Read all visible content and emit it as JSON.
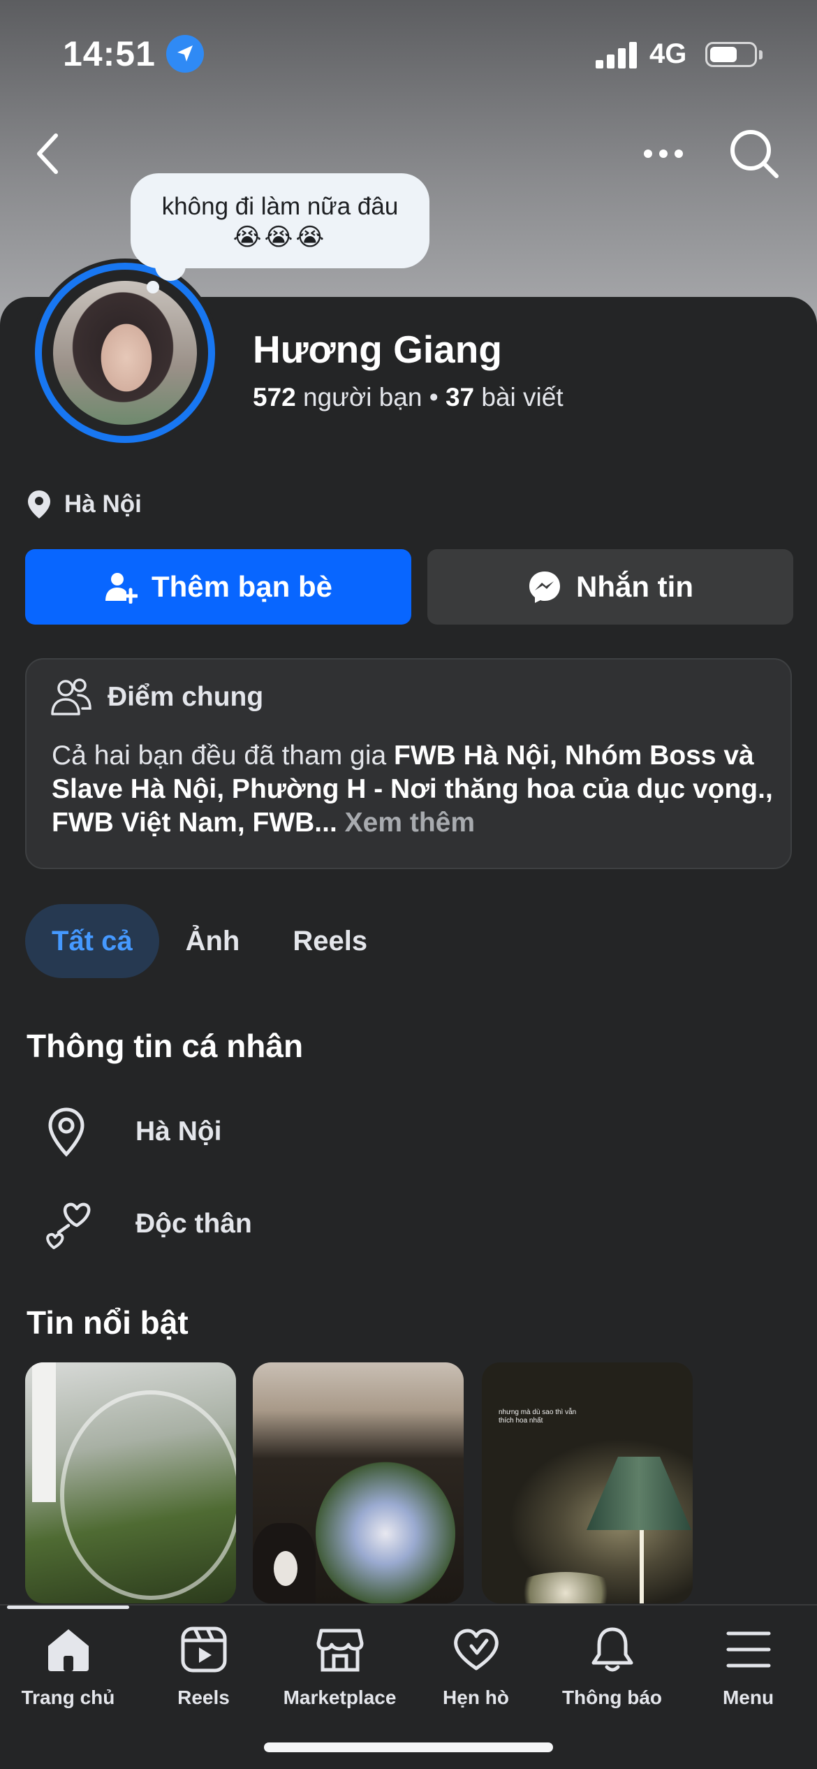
{
  "status_bar": {
    "time": "14:51",
    "network": "4G",
    "battery_level": 0.6
  },
  "colors": {
    "accent": "#0866ff",
    "ring": "#1877f2",
    "background": "#242526",
    "active_tab_bg": "#263951",
    "active_tab_text": "#4599ff"
  },
  "profile": {
    "status_note": "không đi làm nữa đâu",
    "status_emoji": "😭😭😭",
    "name": "Hương Giang",
    "friends_count": "572",
    "friends_label": " người bạn",
    "separator": " • ",
    "posts_count": "37",
    "posts_label": " bài viết",
    "location": "Hà Nội"
  },
  "actions": {
    "add_friend": "Thêm bạn bè",
    "message": "Nhắn tin"
  },
  "common": {
    "title": "Điểm chung",
    "text_prefix": "Cả hai bạn đều đã tham gia ",
    "groups_bold": "FWB Hà Nội, Nhóm Boss và Slave Hà Nội, Phường H - Nơi thăng hoa của dục vọng., FWB Việt Nam, FWB",
    "ellipsis": "... ",
    "see_more": "Xem thêm"
  },
  "filter_tabs": [
    {
      "label": "Tất cả",
      "active": true
    },
    {
      "label": "Ảnh",
      "active": false
    },
    {
      "label": "Reels",
      "active": false
    }
  ],
  "personal_info": {
    "title": "Thông tin cá nhân",
    "location": "Hà Nội",
    "relationship": "Độc thân"
  },
  "highlights": {
    "title": "Tin nổi bật",
    "story3_caption": "nhưng mà dù sao thì vẫn thích hoa nhất"
  },
  "bottom_nav": [
    {
      "label": "Trang chủ",
      "icon": "home-icon"
    },
    {
      "label": "Reels",
      "icon": "reels-icon"
    },
    {
      "label": "Marketplace",
      "icon": "marketplace-icon"
    },
    {
      "label": "Hẹn hò",
      "icon": "dating-heart-icon"
    },
    {
      "label": "Thông báo",
      "icon": "bell-icon"
    },
    {
      "label": "Menu",
      "icon": "menu-icon"
    }
  ]
}
